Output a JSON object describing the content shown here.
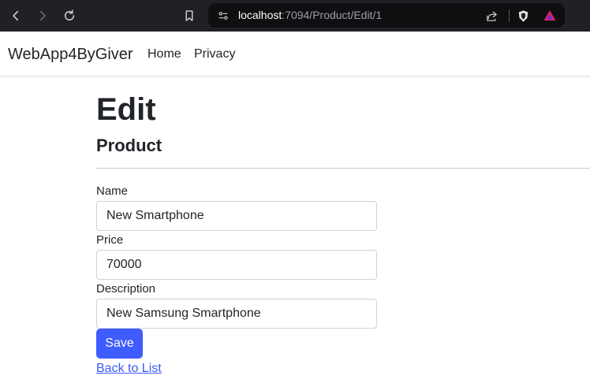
{
  "browser": {
    "address_host": "localhost",
    "address_rest": ":7094/Product/Edit/1"
  },
  "navbar": {
    "brand": "WebApp4ByGiver",
    "links": [
      "Home",
      "Privacy"
    ]
  },
  "page": {
    "title": "Edit",
    "subtitle": "Product"
  },
  "form": {
    "name_label": "Name",
    "name_value": "New Smartphone",
    "price_label": "Price",
    "price_value": "70000",
    "description_label": "Description",
    "description_value": "New Samsung Smartphone",
    "save_label": "Save"
  },
  "back_link": "Back to List"
}
